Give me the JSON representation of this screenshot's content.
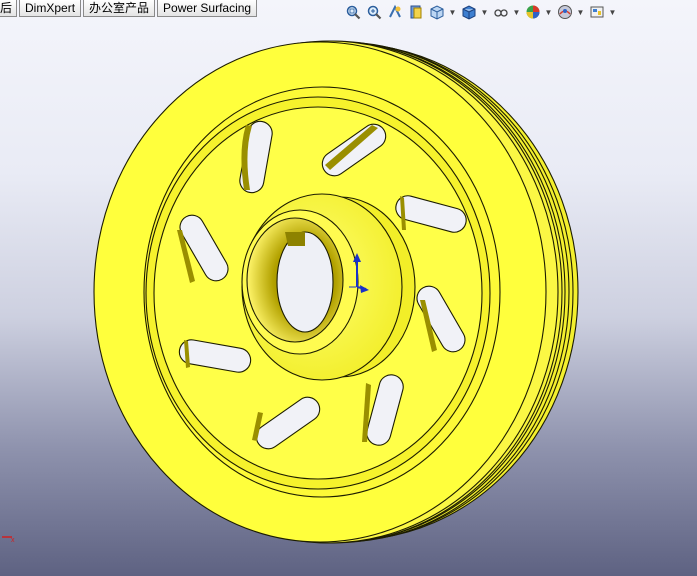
{
  "tabs": [
    {
      "label": "后"
    },
    {
      "label": "DimXpert"
    },
    {
      "label": "办公室产品"
    },
    {
      "label": "Power Surfacing"
    }
  ],
  "toolbar": {
    "icons": [
      "zoom-to-fit-icon",
      "zoom-area-icon",
      "previous-view-icon",
      "section-view-icon",
      "view-orientation-icon",
      "display-style-icon",
      "hide-show-items-icon",
      "edit-appearance-icon",
      "apply-scene-icon",
      "view-settings-icon"
    ]
  },
  "colors": {
    "part": "#ffff33",
    "edge": "#1c1c00",
    "background_top": "#f4f5fb",
    "background_bottom": "#5e6282"
  }
}
